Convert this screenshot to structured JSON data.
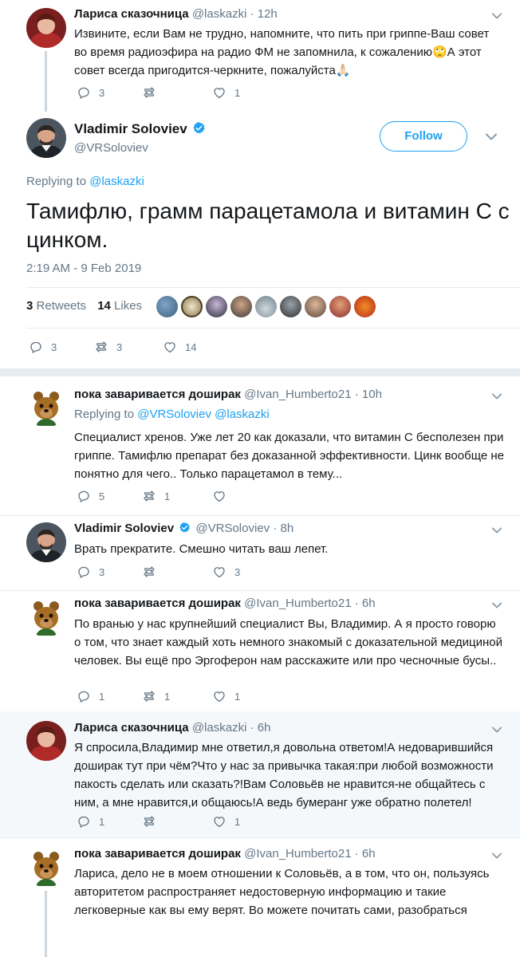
{
  "tweets": {
    "t1": {
      "name": "Лариса сказочница",
      "handle": "@laskazki",
      "dot": "·",
      "time": "12h",
      "text": "Извините, если Вам не трудно, напомните, что пить при гриппе-Ваш совет во время радиоэфира на радио ФМ не запомнила, к сожалению🙄А этот совет всегда пригодится-черкните, пожалуйста🙏🏻",
      "replies": "3",
      "retweets": "",
      "likes": "1"
    },
    "main": {
      "name": "Vladimir Soloviev",
      "handle": "@VRSoloviev",
      "follow_label": "Follow",
      "replying_prefix": "Replying to",
      "replying_to": "@laskazki",
      "text": "Тамифлю, грамм парацетамола и витамин С с цинком.",
      "date": "2:19 AM - 9 Feb 2019",
      "retweets_count": "3",
      "retweets_label": "Retweets",
      "likes_count": "14",
      "likes_label": "Likes",
      "replies": "3",
      "retweets": "3",
      "likes": "14"
    },
    "t2": {
      "name": "пока заваривается доширак",
      "handle": "@Ivan_Humberto21",
      "dot": "·",
      "time": "10h",
      "replying_prefix": "Replying to",
      "replying_to": "@VRSoloviev @laskazki",
      "text": "Специалист хренов. Уже лет 20 как доказали, что витамин С бесполезен при гриппе. Тамифлю препарат без доказанной эффективности. Цинк вообще не понятно для чего.. Только парацетамол в тему...",
      "replies": "5",
      "retweets": "1",
      "likes": ""
    },
    "t3": {
      "name": "Vladimir Soloviev",
      "handle": "@VRSoloviev",
      "dot": "·",
      "time": "8h",
      "text": "Врать прекратите. Смешно читать ваш лепет.",
      "replies": "3",
      "retweets": "",
      "likes": "3"
    },
    "t4": {
      "name": "пока заваривается доширак",
      "handle": "@Ivan_Humberto21",
      "dot": "·",
      "time": "6h",
      "text": "По вранью у нас крупнейший специалист Вы, Владимир. А я просто говорю о том, что знает каждый хоть немного знакомый с доказательной медициной человек. Вы ещё про Эргоферон нам расскажите или про чесночные бусы..",
      "replies": "1",
      "retweets": "1",
      "likes": "1"
    },
    "t5": {
      "name": "Лариса сказочница",
      "handle": "@laskazki",
      "dot": "·",
      "time": "6h",
      "text": "Я спросила,Владимир мне ответил,я довольна ответом!А недоварившийся доширак тут при чём?Что у нас за привычка такая:при любой возможности пакость сделать или сказать?!Вам Соловьёв не нравится-не общайтесь с ним, а мне нравится,и общаюсь!А ведь бумеранг уже обратно полетел!",
      "replies": "1",
      "retweets": "",
      "likes": "1"
    },
    "t6": {
      "name": "пока заваривается доширак",
      "handle": "@Ivan_Humberto21",
      "dot": "·",
      "time": "6h",
      "text": "Лариса, дело не в моем отношении к Соловьёв, а в том, что он, пользуясь авторитетом распространяет недостоверную информацию и такие легковерные как вы ему верят. Во можете почитать сами, разобраться"
    }
  },
  "colors": {
    "accent": "#1da1f2",
    "muted": "#657786",
    "text": "#14171a",
    "highlight_bg": "#f5f8fa"
  }
}
